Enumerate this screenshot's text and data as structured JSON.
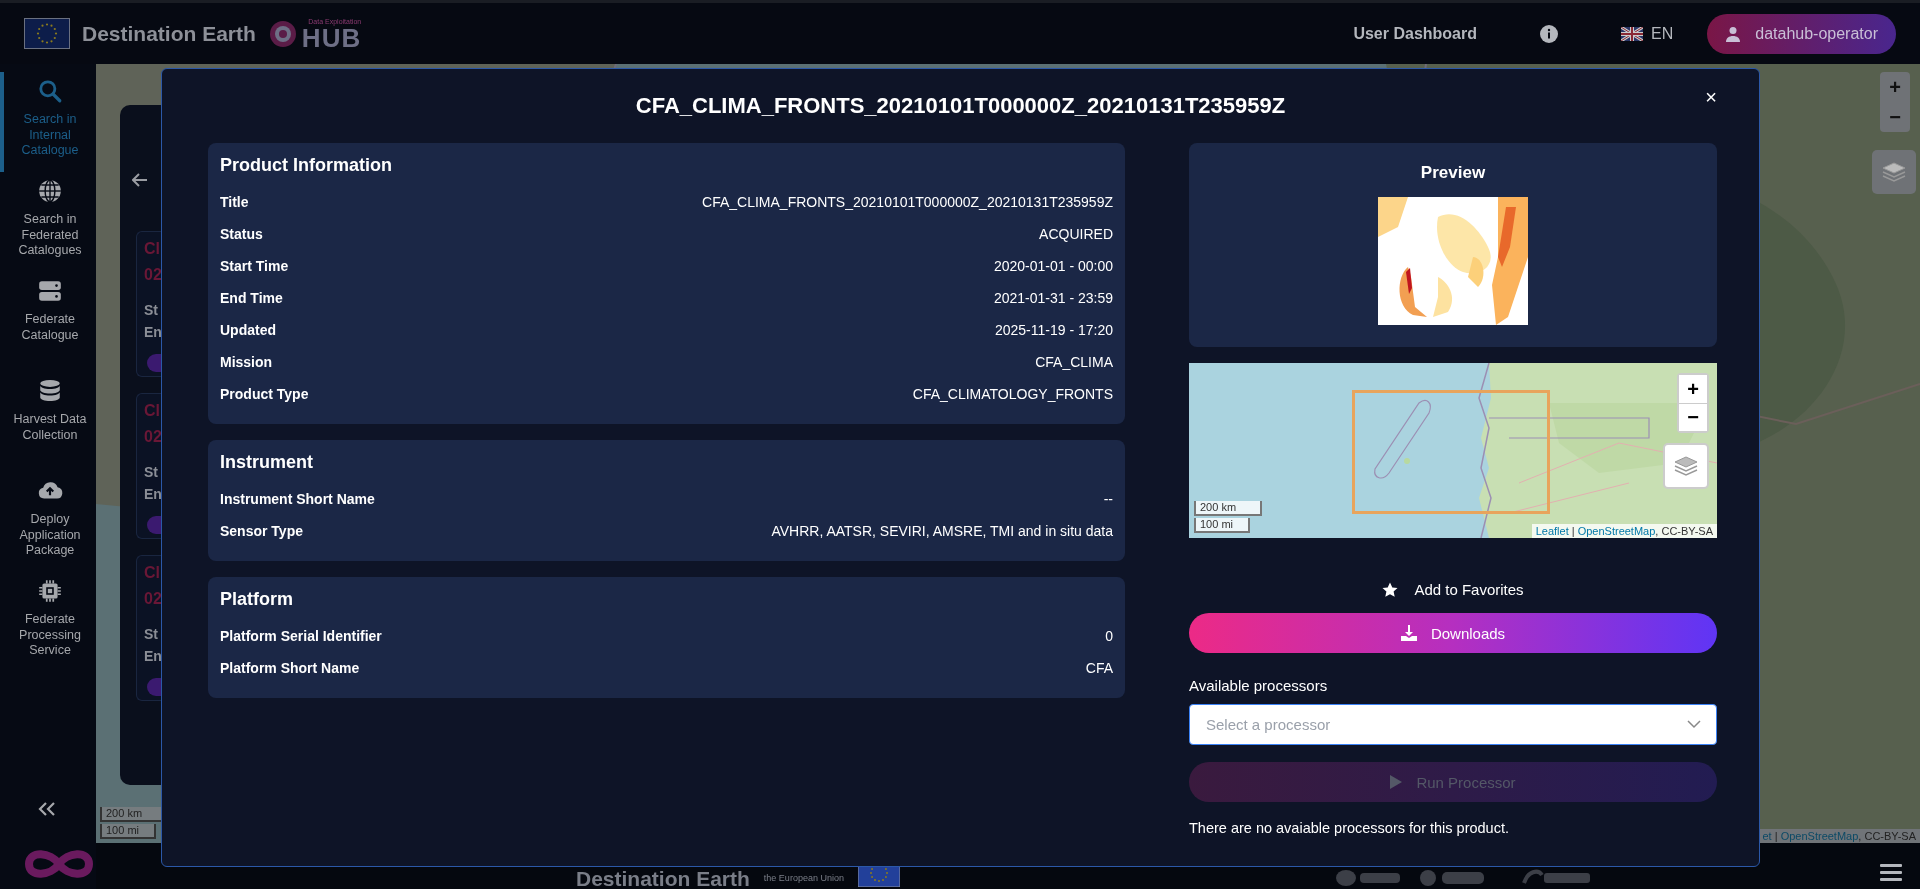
{
  "header": {
    "brand": "Destination Earth",
    "hub_caption": "Data Exploitation",
    "hub": "HUB",
    "nav_link": "User Dashboard",
    "language": "EN",
    "user": "datahub-operator"
  },
  "sidebar": {
    "items": [
      {
        "label": "Search in Internal Catalogue",
        "selected": true
      },
      {
        "label": "Search in Federated Catalogues",
        "selected": false
      },
      {
        "label": "Federate Catalogue",
        "selected": false
      },
      {
        "label": "Harvest Data Collection",
        "selected": false
      },
      {
        "label": "Deploy Application Package",
        "selected": false
      },
      {
        "label": "Federate Processing Service",
        "selected": false
      }
    ]
  },
  "results_panel": {
    "cards": [
      {
        "title": "Cl",
        "code": "02",
        "lines": [
          "St",
          "En"
        ]
      },
      {
        "title": "Cl",
        "code": "02",
        "lines": [
          "St",
          "En"
        ]
      },
      {
        "title": "Cl",
        "code": "02",
        "lines": [
          "St",
          "En"
        ]
      }
    ]
  },
  "map": {
    "zoom_in": "+",
    "zoom_out": "−",
    "scale": [
      "200 km",
      "100 mi"
    ],
    "attribution": {
      "links": [
        "et",
        "OpenStreetMap"
      ],
      "separator": "|",
      "suffix": ", CC-BY-SA"
    }
  },
  "footer": {
    "brand": "Destination Earth",
    "caption": "the European Union"
  },
  "modal": {
    "title": "CFA_CLIMA_FRONTS_20210101T000000Z_20210131T235959Z",
    "close": "×",
    "sections": [
      {
        "heading": "Product Information",
        "rows": [
          {
            "label": "Title",
            "value": "CFA_CLIMA_FRONTS_20210101T000000Z_20210131T235959Z"
          },
          {
            "label": "Status",
            "value": "ACQUIRED"
          },
          {
            "label": "Start Time",
            "value": "2020-01-01 - 00:00"
          },
          {
            "label": "End Time",
            "value": "2021-01-31 - 23:59"
          },
          {
            "label": "Updated",
            "value": "2025-11-19 - 17:20"
          },
          {
            "label": "Mission",
            "value": "CFA_CLIMA"
          },
          {
            "label": "Product Type",
            "value": "CFA_CLIMATOLOGY_FRONTS"
          }
        ]
      },
      {
        "heading": "Instrument",
        "rows": [
          {
            "label": "Instrument Short Name",
            "value": "--"
          },
          {
            "label": "Sensor Type",
            "value": "AVHRR, AATSR, SEVIRI, AMSRE, TMI and in situ data"
          }
        ]
      },
      {
        "heading": "Platform",
        "rows": [
          {
            "label": "Platform Serial Identifier",
            "value": "0"
          },
          {
            "label": "Platform Short Name",
            "value": "CFA"
          }
        ]
      }
    ],
    "preview": {
      "heading": "Preview"
    },
    "map": {
      "zoom_in": "+",
      "zoom_out": "−",
      "scale": [
        "200 km",
        "100 mi"
      ],
      "attribution": {
        "links": [
          "Leaflet",
          "OpenStreetMap"
        ],
        "separator": "|",
        "suffix": ", CC-BY-SA"
      }
    },
    "favorite": "Add to Favorites",
    "download": "Downloads",
    "processors": {
      "label": "Available processors",
      "placeholder": "Select a processor"
    },
    "run": {
      "label": "Run Processor",
      "disabled": true
    },
    "note": "There are no avaiable processors for this product."
  }
}
